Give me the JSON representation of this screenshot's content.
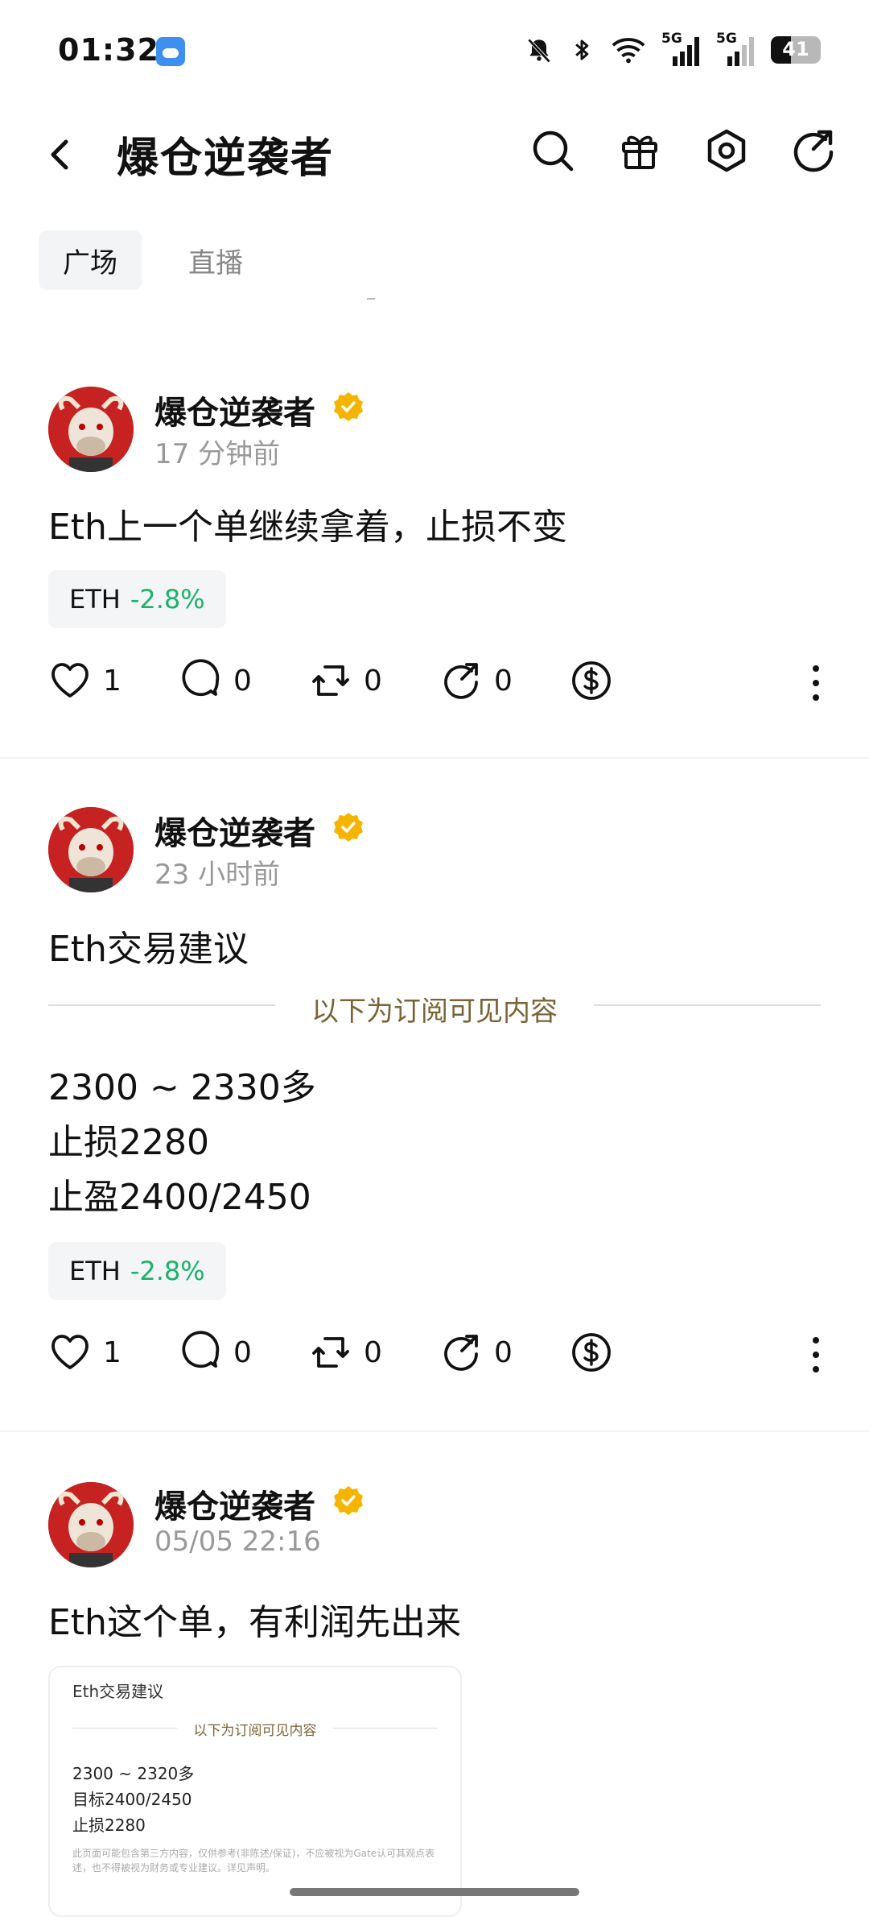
{
  "status_bar": {
    "time": "01:32",
    "battery_level": "41",
    "signal_1": "5G",
    "signal_2": "5G"
  },
  "header": {
    "title": "爆仓逆袭者"
  },
  "tabs": [
    {
      "label": "广场",
      "active": true
    },
    {
      "label": "直播",
      "active": false
    }
  ],
  "posts": [
    {
      "author": "爆仓逆袭者",
      "time": "17 分钟前",
      "text": "Eth上一个单继续拿着，止损不变",
      "tag": {
        "symbol": "ETH",
        "change": "-2.8%"
      },
      "likes": "1",
      "comments": "0",
      "reposts": "0",
      "shares": "0"
    },
    {
      "author": "爆仓逆袭者",
      "time": "23 小时前",
      "text": "Eth交易建议",
      "subscriber_divider": "以下为订阅可见内容",
      "lines": [
        "2300 ~ 2330多",
        "止损2280",
        "止盈2400/2450"
      ],
      "tag": {
        "symbol": "ETH",
        "change": "-2.8%"
      },
      "likes": "1",
      "comments": "0",
      "reposts": "0",
      "shares": "0"
    },
    {
      "author": "爆仓逆袭者",
      "time": "05/05 22:16",
      "text": "Eth这个单，有利润先出来",
      "quote": {
        "title": "Eth交易建议",
        "divider": "以下为订阅可见内容",
        "lines": [
          "2300 ~ 2320多",
          "目标2400/2450",
          "止损2280"
        ],
        "disclaimer": "此页面可能包含第三方内容，仅供参考(非陈述/保证)，不应被视为Gate认可其观点表述，也不得被视为财务或专业建议。详见声明。"
      }
    }
  ],
  "colors": {
    "positive_change": "#1bb36c",
    "verified_badge": "#f5b400",
    "subscriber_text": "#7a6436"
  }
}
